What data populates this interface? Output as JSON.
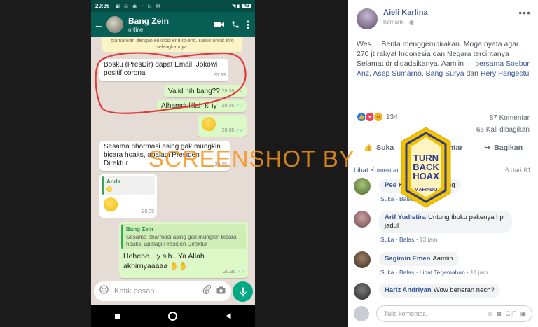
{
  "whatsapp": {
    "status_time": "20:36",
    "battery": "43",
    "contact_name": "Bang Zein",
    "contact_status": "online",
    "encryption_notice": "diamankan dengan enkripsi end-to-end. Ketuk untuk info selengkapnya.",
    "messages": [
      {
        "dir": "in",
        "text": "Bosku (PresDir) dapat Email, Jokowi positif corona",
        "time": "20.33"
      },
      {
        "dir": "out",
        "text": "Valid nih bang??",
        "time": "20.35"
      },
      {
        "dir": "out",
        "text": "Alhamdulillah kl iy",
        "time": "20.35"
      },
      {
        "dir": "out",
        "text": "",
        "time": "20.35"
      },
      {
        "dir": "in",
        "text": "Sesama pharmasi asing gak mungkin bicara hoaks, apalagi Presiden Direktur",
        "time": "20.35"
      },
      {
        "dir": "in",
        "text": "",
        "quote_name": "Anda",
        "time": "20.35"
      },
      {
        "dir": "out",
        "text": "Hehehe.. iy sih.. Ya Allah akhirnyaaaaa",
        "quote_name": "Bang Zein",
        "quote_text": "Sesama pharmasi asing gak mungkin bicara hoaks, apalagi Presiden Direktur",
        "time": "20.36"
      }
    ],
    "input_placeholder": "Ketik pesan"
  },
  "watermark": "SCREENSHOT BY",
  "badge": {
    "ring_text": "MASYARAKAT ANTI FITNAH INDONESIA",
    "lines": [
      "TURN",
      "BACK",
      "HOAX"
    ],
    "bottom": "MAFINDO"
  },
  "facebook": {
    "author": "Aieli Karlina",
    "time": "Kemarin",
    "post_text": "Wes.... Berita menggembirakan. Moga nyata agar 270 jt rakyat Indonesia dan Negara tercintanya Selamat dr digadaikanya. Aamiin",
    "tag_intro": "— bersama",
    "tags": [
      "Soebur Anz",
      "Asep Sumarno",
      "Bang Surya",
      "Hery Pangestu"
    ],
    "tag_and": "dan",
    "reaction_count": "134",
    "comments_count": "87 Komentar",
    "shares_count": "66 Kali dibagikan",
    "actions": [
      "Suka",
      "Komentar",
      "Bagikan"
    ],
    "prev_comments": "Lihat Komentar Sebelumnya",
    "prev_count": "6 dari 61",
    "comments": [
      {
        "name": "Pee",
        "text": "Kenek telek paleng",
        "time": "14 jam",
        "translate": "",
        "avatar": "#6f9a4a"
      },
      {
        "name": "Arif Yudistira",
        "text": "Untung ibuku pakenya hp jadul",
        "time": "13 jam",
        "translate": "",
        "avatar": "#8a6b6b"
      },
      {
        "name": "Sagimin Emen",
        "text": "Aamiin",
        "time": "11 jam",
        "translate": "Lihat Terjemahan",
        "avatar": "#5a4a3a"
      },
      {
        "name": "Hariz Andriyan",
        "text": "Wow beneran nech?",
        "time": "",
        "translate": "",
        "avatar": "#3f3f3f"
      }
    ],
    "link_like": "Suka",
    "link_reply": "Balas",
    "write_placeholder": "Tulis komentar..."
  }
}
